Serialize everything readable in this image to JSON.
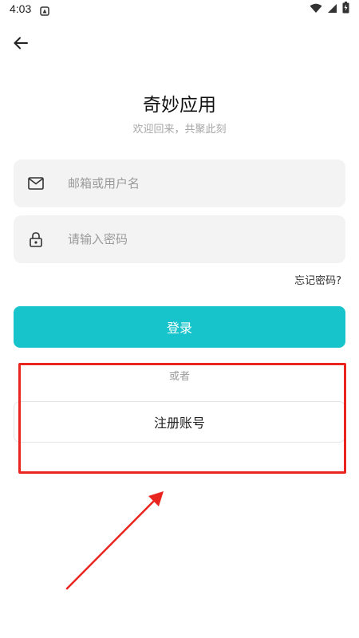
{
  "status_bar": {
    "time": "4:03",
    "icons": [
      "notification-icon",
      "wifi-icon",
      "signal-icon",
      "battery-icon"
    ]
  },
  "header": {
    "back_icon": "arrow-left-icon"
  },
  "brand": {
    "title": "奇妙应用",
    "subtitle": "欢迎回来，共聚此刻"
  },
  "form": {
    "email_placeholder": "邮箱或用户名",
    "email_value": "",
    "email_icon": "mail-icon",
    "password_placeholder": "请输入密码",
    "password_value": "",
    "password_icon": "lock-icon",
    "forgot_label": "忘记密码?"
  },
  "actions": {
    "login_label": "登录",
    "or_label": "或者",
    "register_label": "注册账号"
  },
  "colors": {
    "accent": "#17c4cb",
    "annotation": "#e8261f",
    "field_bg": "#f3f3f3"
  }
}
